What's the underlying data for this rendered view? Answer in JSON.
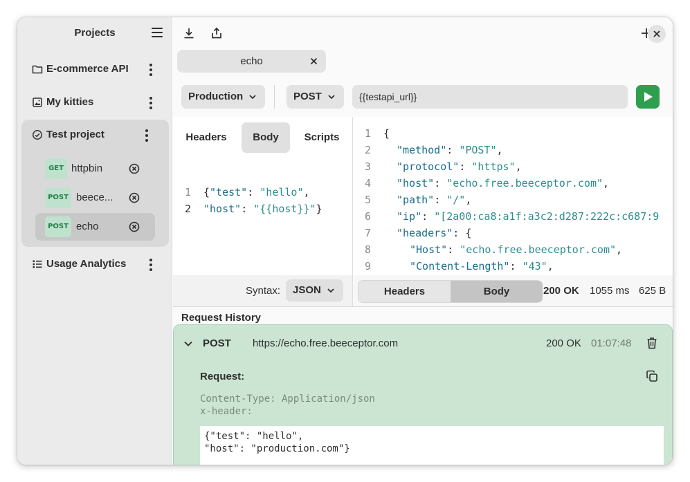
{
  "sidebar": {
    "title": "Projects",
    "projects": [
      {
        "label": "E-commerce API",
        "icon": "folder-icon"
      },
      {
        "label": "My kitties",
        "icon": "image-icon"
      },
      {
        "label": "Test project",
        "icon": "clock-icon"
      },
      {
        "label": "Usage Analytics",
        "icon": "list-icon"
      }
    ],
    "requests": [
      {
        "method": "GET",
        "label": "httpbin"
      },
      {
        "method": "POST",
        "label": "beece..."
      },
      {
        "method": "POST",
        "label": "echo"
      }
    ]
  },
  "tab": {
    "label": "echo"
  },
  "toolbar": {
    "environment": "Production",
    "method": "POST",
    "url": "{{testapi_url}}"
  },
  "request_pane": {
    "tabs": [
      "Headers",
      "Body",
      "Scripts"
    ],
    "active_tab": "Body",
    "line_numbers": [
      "1",
      "2"
    ],
    "body_lines": [
      {
        "k": "\"test\"",
        "v": "\"hello\"",
        "open": "{",
        "tail": ","
      },
      {
        "k": "\"host\"",
        "v": "\"{{host}}\"",
        "open": "",
        "tail": "}"
      }
    ],
    "syntax_label": "Syntax:",
    "syntax_value": "JSON"
  },
  "response_pane": {
    "line_numbers": [
      "1",
      "2",
      "3",
      "4",
      "5",
      "6",
      "7",
      "8",
      "9"
    ],
    "lines": {
      "l1": "{",
      "l2k": "\"method\"",
      "l2v": "\"POST\"",
      "l3k": "\"protocol\"",
      "l3v": "\"https\"",
      "l4k": "\"host\"",
      "l4v": "\"echo.free.beeceptor.com\"",
      "l5k": "\"path\"",
      "l5v": "\"/\"",
      "l6k": "\"ip\"",
      "l6v": "\"[2a00:ca8:a1f:a3c2:d287:222c:c687:9",
      "l7k": "\"headers\"",
      "l7p": "{",
      "l8k": "\"Host\"",
      "l8v": "\"echo.free.beeceptor.com\"",
      "l9k": "\"Content-Length\"",
      "l9v": "\"43\""
    },
    "tabs": [
      "Headers",
      "Body"
    ],
    "active_tab": "Body",
    "status": "200 OK",
    "time": "1055 ms",
    "size": "625 B"
  },
  "history": {
    "title": "Request History",
    "entry": {
      "method": "POST",
      "url": "https://echo.free.beeceptor.com",
      "status": "200 OK",
      "time": "01:07:48",
      "request_label": "Request:",
      "headers_line1": "Content-Type: Application/json",
      "headers_line2": "x-header:",
      "body_line1": "{\"test\": \"hello\",",
      "body_line2": "\"host\": \"production.com\"}"
    }
  },
  "colors": {
    "accent": "#2e9e4f",
    "history_bg": "#cce5d2",
    "badge_bg": "#bfe2cf",
    "badge_text": "#26804a"
  }
}
